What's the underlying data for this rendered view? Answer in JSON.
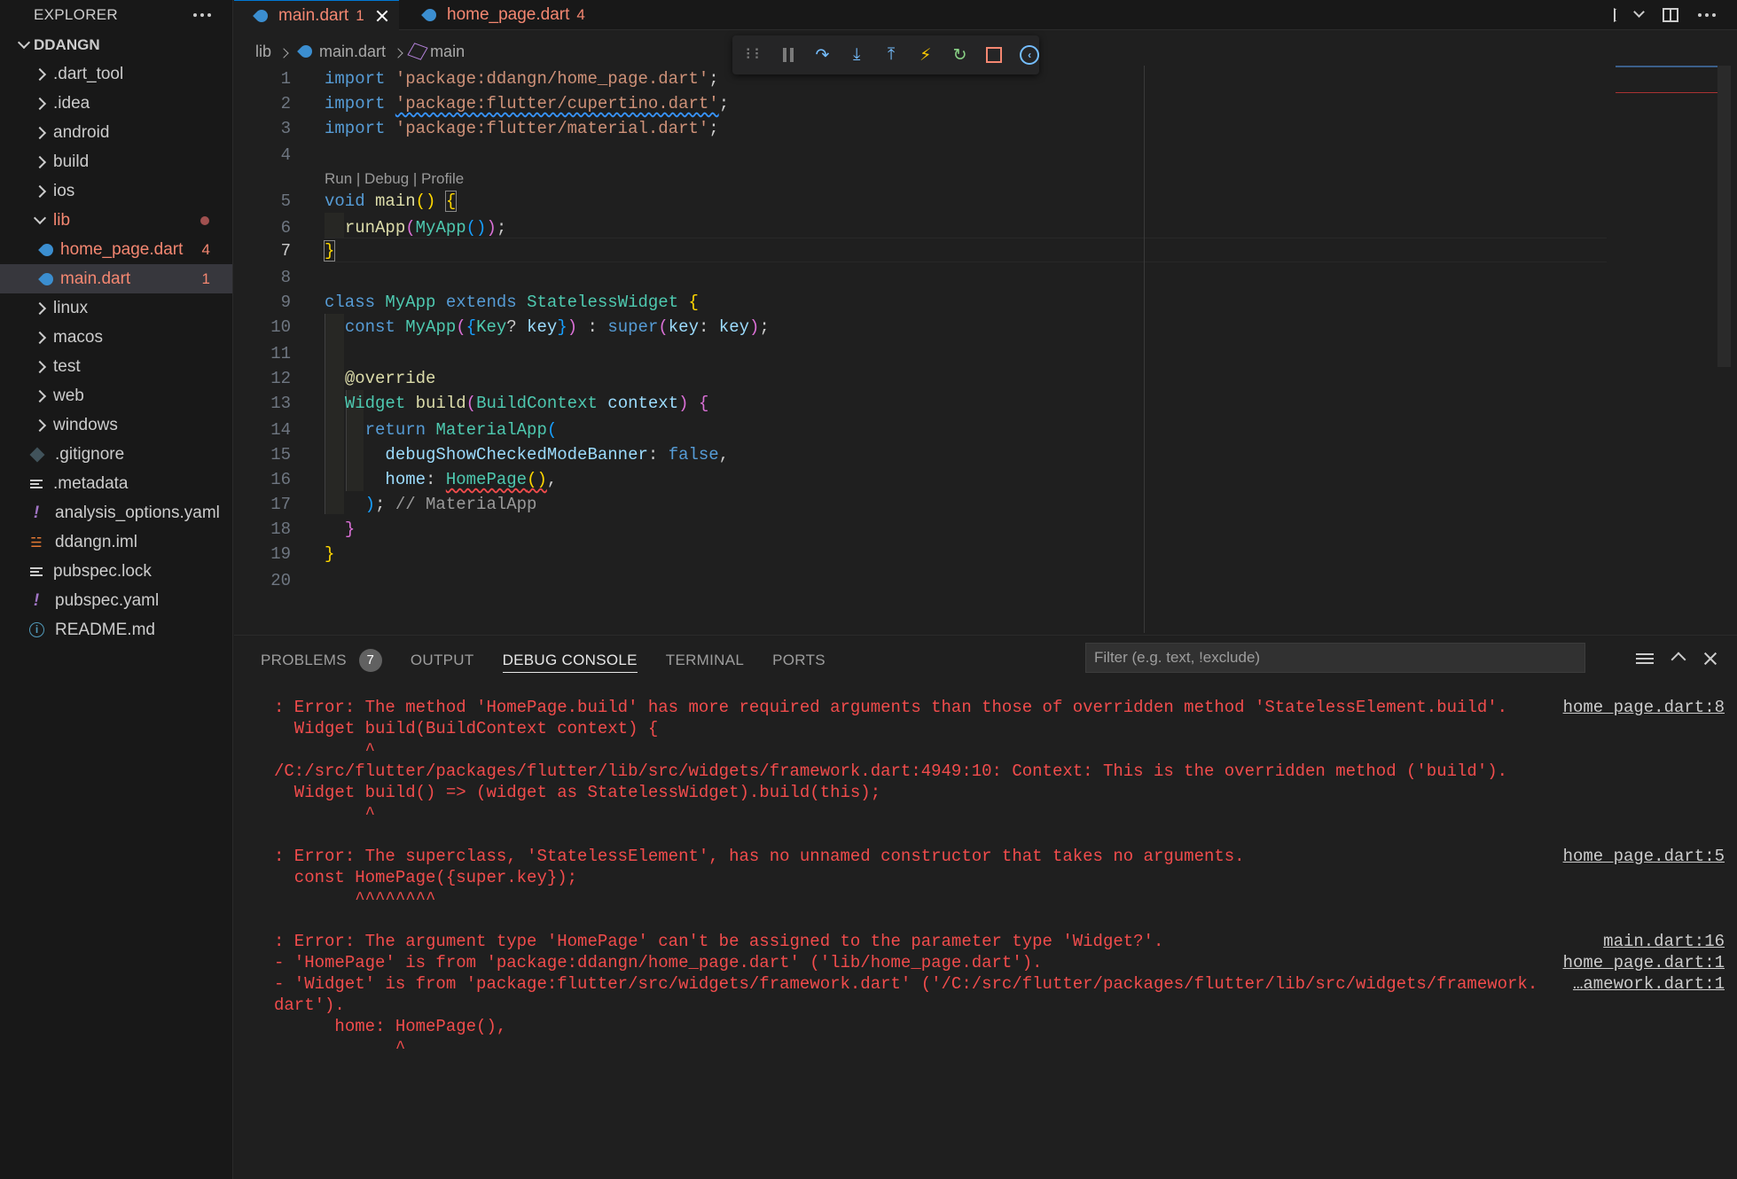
{
  "sidebar": {
    "title": "EXPLORER",
    "project": "DDANGN",
    "items": [
      {
        "label": ".dart_tool"
      },
      {
        "label": ".idea"
      },
      {
        "label": "android"
      },
      {
        "label": "build"
      },
      {
        "label": "ios"
      },
      {
        "label": "lib"
      },
      {
        "label": "home_page.dart",
        "badge": "4"
      },
      {
        "label": "main.dart",
        "badge": "1"
      },
      {
        "label": "linux"
      },
      {
        "label": "macos"
      },
      {
        "label": "test"
      },
      {
        "label": "web"
      },
      {
        "label": "windows"
      },
      {
        "label": ".gitignore"
      },
      {
        "label": ".metadata"
      },
      {
        "label": "analysis_options.yaml"
      },
      {
        "label": "ddangn.iml"
      },
      {
        "label": "pubspec.lock"
      },
      {
        "label": "pubspec.yaml"
      },
      {
        "label": "README.md"
      }
    ]
  },
  "tabs": [
    {
      "label": "main.dart",
      "count": "1"
    },
    {
      "label": "home_page.dart",
      "count": "4"
    }
  ],
  "breadcrumb": {
    "folder": "lib",
    "file": "main.dart",
    "symbol": "main"
  },
  "editor": {
    "line_numbers": [
      "1",
      "2",
      "3",
      "4",
      "5",
      "6",
      "7",
      "8",
      "9",
      "10",
      "11",
      "12",
      "13",
      "14",
      "15",
      "16",
      "17",
      "18",
      "19",
      "20"
    ],
    "codelens": "Run | Debug | Profile",
    "lines": {
      "l1_kw": "import",
      "l1_str": "'package:ddangn/home_page.dart'",
      "l1_end": ";",
      "l2_kw": "import",
      "l2_str": "'package:flutter/cupertino.dart'",
      "l2_end": ";",
      "l3_kw": "import",
      "l3_str": "'package:flutter/material.dart'",
      "l3_end": ";",
      "l5_kw": "void",
      "l5_fn": "main",
      "l5_paren": "()",
      "l5_brace": "{",
      "l6_fn": "runApp",
      "l6_p1": "(",
      "l6_cls": "MyApp",
      "l6_p2": "()",
      "l6_p3": ")",
      "l6_end": ";",
      "l7_brace": "}",
      "l9_kw1": "class",
      "l9_cls1": "MyApp",
      "l9_kw2": "extends",
      "l9_cls2": "StatelessWidget",
      "l9_brace": "{",
      "l10_kw": "const",
      "l10_cls": "MyApp",
      "l10_p1": "(",
      "l10_b1": "{",
      "l10_cls2": "Key",
      "l10_q": "?",
      "l10_var": "key",
      "l10_b2": "}",
      "l10_p2": ")",
      "l10_colon": " : ",
      "l10_kw2": "super",
      "l10_p3": "(",
      "l10_var2": "key",
      "l10_colon2": ": ",
      "l10_var3": "key",
      "l10_p4": ")",
      "l10_end": ";",
      "l12_ann": "@override",
      "l13_cls": "Widget",
      "l13_fn": "build",
      "l13_p1": "(",
      "l13_cls2": "BuildContext",
      "l13_var": "context",
      "l13_p2": ")",
      "l13_brace": "{",
      "l14_kw": "return",
      "l14_cls": "MaterialApp",
      "l14_p": "(",
      "l15_var": "debugShowCheckedModeBanner",
      "l15_colon": ": ",
      "l15_kw": "false",
      "l15_end": ",",
      "l16_var": "home",
      "l16_colon": ": ",
      "l16_cls": "HomePage",
      "l16_p": "()",
      "l16_end": ",",
      "l17_p": ")",
      "l17_end": ";",
      "l17_cm": "// MaterialApp",
      "l18_brace": "}",
      "l19_brace": "}"
    }
  },
  "panel": {
    "tabs": [
      {
        "label": "PROBLEMS",
        "badge": "7"
      },
      {
        "label": "OUTPUT"
      },
      {
        "label": "DEBUG CONSOLE"
      },
      {
        "label": "TERMINAL"
      },
      {
        "label": "PORTS"
      }
    ],
    "filter_placeholder": "Filter (e.g. text, !exclude)",
    "console": [
      {
        "text": ": Error: The method 'HomePage.build' has more required arguments than those of overridden method 'StatelessElement.build'.",
        "src": "home_page.dart:8"
      },
      {
        "text": "  Widget build(BuildContext context) {"
      },
      {
        "text": "         ^"
      },
      {
        "text": "/C:/src/flutter/packages/flutter/lib/src/widgets/framework.dart:4949:10: Context: This is the overridden method ('build')."
      },
      {
        "text": "  Widget build() => (widget as StatelessWidget).build(this);"
      },
      {
        "text": "         ^"
      },
      {
        "text": ": Error: The superclass, 'StatelessElement', has no unnamed constructor that takes no arguments.",
        "src": "home_page.dart:5"
      },
      {
        "text": "  const HomePage({super.key});"
      },
      {
        "text": "        ^^^^^^^^"
      },
      {
        "text": ": Error: The argument type 'HomePage' can't be assigned to the parameter type 'Widget?'.",
        "src": "main.dart:16"
      },
      {
        "text": "- 'HomePage' is from 'package:ddangn/home_page.dart' ('lib/home_page.dart').",
        "src": "home_page.dart:1"
      },
      {
        "text": "- 'Widget' is from 'package:flutter/src/widgets/framework.dart' ('/C:/src/flutter/packages/flutter/lib/src/widgets/framework.",
        "src": "…amework.dart:1"
      },
      {
        "text": "dart')."
      },
      {
        "text": "      home: HomePage(),"
      },
      {
        "text": "            ^"
      }
    ]
  },
  "colors": {
    "error": "#f14c4c",
    "accent": "#0078d4",
    "tab_error": "#f48771"
  }
}
